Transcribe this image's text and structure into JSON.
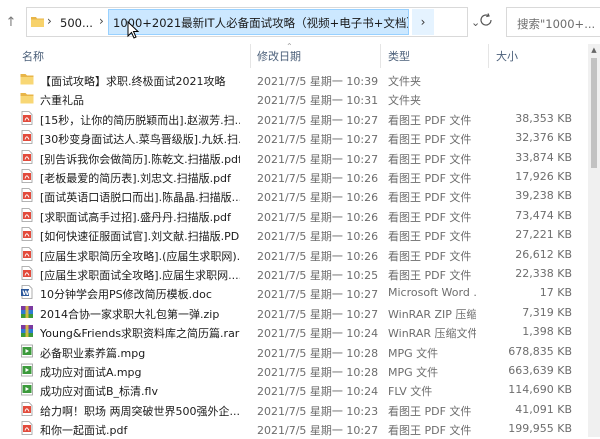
{
  "address_bar": {
    "crumbs": [
      "500...",
      "1000+2021最新IT人必备面试攻略（视频+电子书+文档）"
    ]
  },
  "search": {
    "placeholder": "搜索\"1000+..."
  },
  "columns": {
    "name": "名称",
    "date": "修改日期",
    "type": "类型",
    "size": "大小"
  },
  "files": [
    {
      "icon": "folder-icon",
      "name": "【面试攻略】求职.终极面试2021攻略",
      "date": "2021/7/5 星期一 10:39",
      "type": "文件夹",
      "size": ""
    },
    {
      "icon": "folder-icon",
      "name": "六重礼品",
      "date": "2021/7/5 星期一 10:31",
      "type": "文件夹",
      "size": ""
    },
    {
      "icon": "pdf-icon",
      "name": "[15秒，让你的简历脱颖而出].赵淑芳.扫...",
      "date": "2021/7/5 星期一 10:27",
      "type": "看图王 PDF 文件",
      "size": "38,353 KB"
    },
    {
      "icon": "pdf-icon",
      "name": "[30秒变身面试达人.菜鸟晋级版].九妖.扫...",
      "date": "2021/7/5 星期一 10:27",
      "type": "看图王 PDF 文件",
      "size": "32,376 KB"
    },
    {
      "icon": "pdf-icon",
      "name": "[别告诉我你会做简历].陈乾文.扫描版.pdf",
      "date": "2021/7/5 星期一 10:27",
      "type": "看图王 PDF 文件",
      "size": "33,874 KB"
    },
    {
      "icon": "pdf-icon",
      "name": "[老板最爱的简历表].刘忠文.扫描版.pdf",
      "date": "2021/7/5 星期一 10:26",
      "type": "看图王 PDF 文件",
      "size": "17,926 KB"
    },
    {
      "icon": "pdf-icon",
      "name": "[面试英语口语脱口而出].陈晶晶.扫描版...",
      "date": "2021/7/5 星期一 10:26",
      "type": "看图王 PDF 文件",
      "size": "39,238 KB"
    },
    {
      "icon": "pdf-icon",
      "name": "[求职面试高手过招].盛丹丹.扫描版.pdf",
      "date": "2021/7/5 星期一 10:26",
      "type": "看图王 PDF 文件",
      "size": "73,474 KB"
    },
    {
      "icon": "pdf-icon",
      "name": "[如何快速征服面试官].刘文献.扫描版.PDF",
      "date": "2021/7/5 星期一 10:26",
      "type": "看图王 PDF 文件",
      "size": "27,221 KB"
    },
    {
      "icon": "pdf-icon",
      "name": "[应届生求职简历全攻略].(应届生求职网)...",
      "date": "2021/7/5 星期一 10:26",
      "type": "看图王 PDF 文件",
      "size": "26,612 KB"
    },
    {
      "icon": "pdf-icon",
      "name": "[应届生求职面试全攻略].应届生求职网....",
      "date": "2021/7/5 星期一 10:25",
      "type": "看图王 PDF 文件",
      "size": "22,338 KB"
    },
    {
      "icon": "word-icon",
      "name": "10分钟学会用PS修改简历模板.doc",
      "date": "2021/7/5 星期一 10:27",
      "type": "Microsoft Word ...",
      "size": "17 KB"
    },
    {
      "icon": "rar-icon",
      "name": "2014合协一家求职大礼包第一弹.zip",
      "date": "2021/7/5 星期一 10:27",
      "type": "WinRAR ZIP 压缩...",
      "size": "7,319 KB"
    },
    {
      "icon": "rar-icon",
      "name": "Young&Friends求职资料库之简历篇.rar",
      "date": "2021/7/5 星期一 10:24",
      "type": "WinRAR 压缩文件",
      "size": "1,398 KB"
    },
    {
      "icon": "video-icon",
      "name": "必备职业素养篇.mpg",
      "date": "2021/7/5 星期一 10:28",
      "type": "MPG 文件",
      "size": "678,835 KB"
    },
    {
      "icon": "video-icon",
      "name": "成功应对面试A.mpg",
      "date": "2021/7/5 星期一 10:28",
      "type": "MPG 文件",
      "size": "663,639 KB"
    },
    {
      "icon": "video-icon",
      "name": "成功应对面试B_标清.flv",
      "date": "2021/7/5 星期一 10:24",
      "type": "FLV 文件",
      "size": "114,690 KB"
    },
    {
      "icon": "pdf-icon",
      "name": "给力啊！职场 两周突破世界500强外企...",
      "date": "2021/7/5 星期一 10:23",
      "type": "看图王 PDF 文件",
      "size": "41,091 KB"
    },
    {
      "icon": "pdf-icon",
      "name": "和你一起面试.pdf",
      "date": "2021/7/5 星期一 10:27",
      "type": "看图王 PDF 文件",
      "size": "199,955 KB"
    }
  ]
}
